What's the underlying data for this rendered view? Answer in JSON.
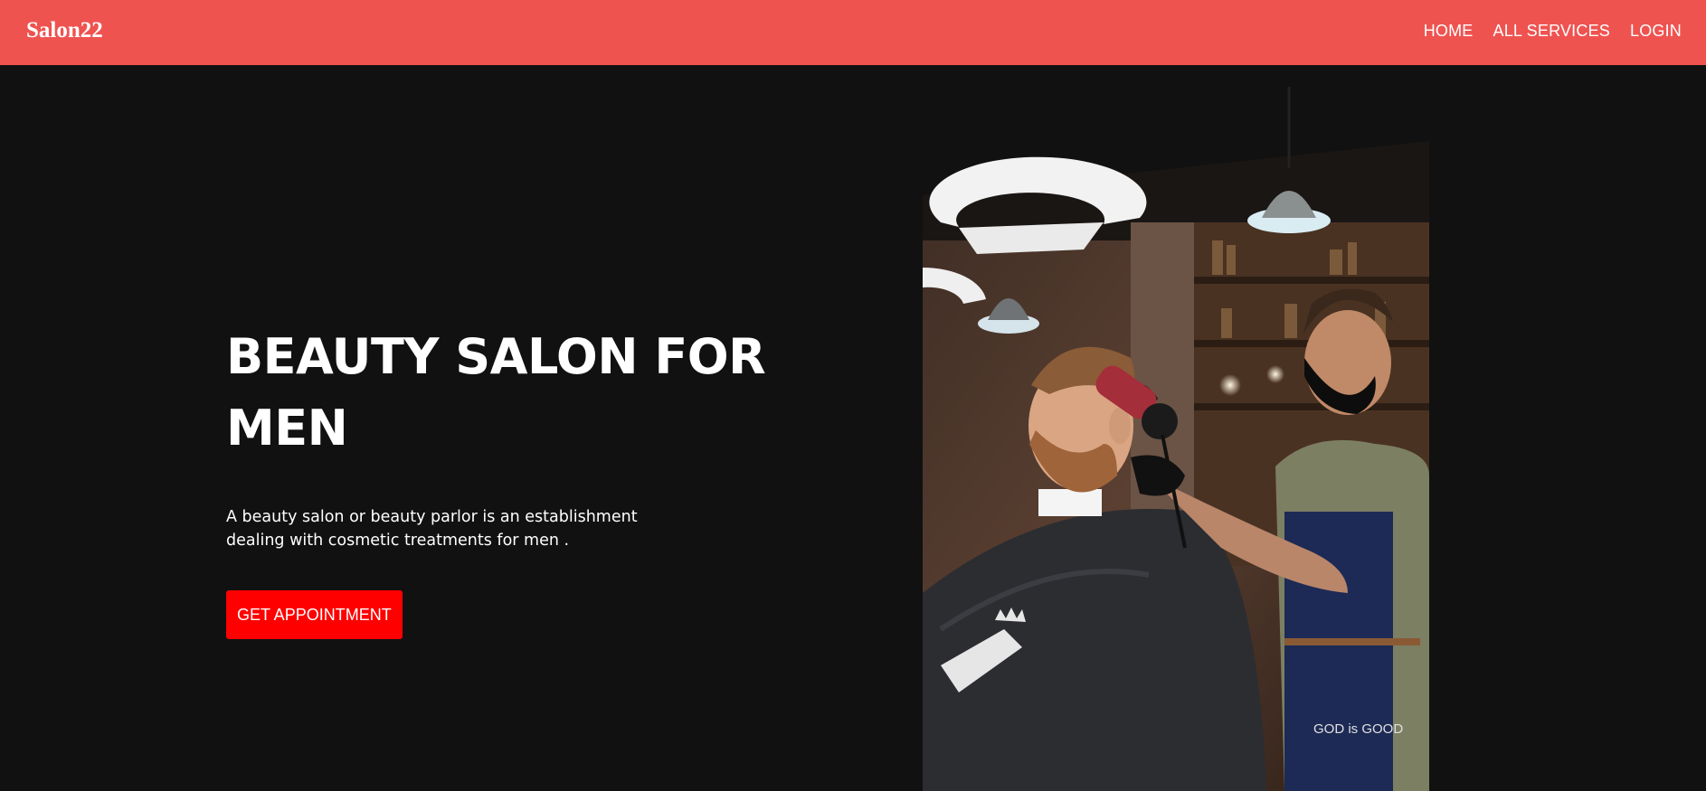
{
  "nav": {
    "brand": "Salon22",
    "links": [
      "HOME",
      "ALL SERVICES",
      "LOGIN"
    ]
  },
  "hero": {
    "title": "BEAUTY SALON FOR MEN",
    "description": "A beauty salon or beauty parlor is an establishment dealing with cosmetic treatments for men .",
    "cta_label": "GET APPOINTMENT",
    "image_alt": "barber drying a client's hair",
    "apron_text": "GOD is GOOD"
  },
  "colors": {
    "navbar": "#ef5350",
    "background": "#111111",
    "cta": "#ff0000",
    "text": "#ffffff"
  }
}
